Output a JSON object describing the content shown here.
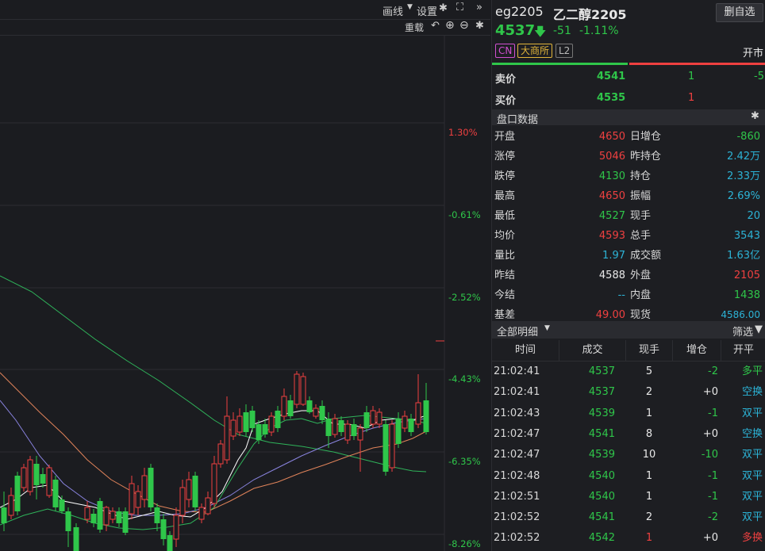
{
  "toolbar": {
    "draw_label": "画线",
    "settings_label": "设置",
    "reload_label": "重载"
  },
  "axis_labels": [
    "1.30%",
    "-0.61%",
    "-2.52%",
    "-4.43%",
    "-6.35%",
    "-8.26%"
  ],
  "axis_colors": {
    "positive": "#ef4040",
    "negative": "#2fc64a"
  },
  "quote": {
    "symbol": "eg2205",
    "name": "乙二醇2205",
    "delete_label": "删自选",
    "price": "4537",
    "change": "-51",
    "change_pct": "-1.11%",
    "tags": [
      "CN",
      "大商所",
      "L2"
    ],
    "status": "开市"
  },
  "order_book": [
    {
      "label": "卖价",
      "price": "4541",
      "vol": "1",
      "delta": "-5"
    },
    {
      "label": "买价",
      "price": "4535",
      "vol": "1",
      "delta": ""
    }
  ],
  "panel_header": "盘口数据",
  "stats_left": [
    {
      "label": "开盘",
      "value": "4650",
      "color": "red"
    },
    {
      "label": "涨停",
      "value": "5046",
      "color": "red"
    },
    {
      "label": "跌停",
      "value": "4130",
      "color": "green"
    },
    {
      "label": "最高",
      "value": "4650",
      "color": "red"
    },
    {
      "label": "最低",
      "value": "4527",
      "color": "green"
    },
    {
      "label": "均价",
      "value": "4593",
      "color": "red"
    },
    {
      "label": "量比",
      "value": "1.97",
      "color": "cyan"
    },
    {
      "label": "昨结",
      "value": "4588",
      "color": "white"
    },
    {
      "label": "今结",
      "value": "--",
      "color": "cyan"
    },
    {
      "label": "基差",
      "value": "49.00",
      "color": "red"
    }
  ],
  "stats_right": [
    {
      "label": "日增仓",
      "value": "-860",
      "color": "green"
    },
    {
      "label": "昨持仓",
      "value": "2.42万",
      "color": "cyan"
    },
    {
      "label": "持仓",
      "value": "2.33万",
      "color": "cyan"
    },
    {
      "label": "振幅",
      "value": "2.69%",
      "color": "cyan"
    },
    {
      "label": "现手",
      "value": "20",
      "color": "cyan"
    },
    {
      "label": "总手",
      "value": "3543",
      "color": "cyan"
    },
    {
      "label": "成交额",
      "value": "1.63亿",
      "color": "cyan"
    },
    {
      "label": "外盘",
      "value": "2105",
      "color": "red"
    },
    {
      "label": "内盘",
      "value": "1438",
      "color": "green"
    },
    {
      "label": "现货",
      "value": "4586.00",
      "color": "cyan"
    }
  ],
  "detail_header": {
    "title": "全部明细",
    "filter_label": "筛选"
  },
  "trade_columns": [
    "时间",
    "成交",
    "现手",
    "增仓",
    "开平"
  ],
  "trades": [
    {
      "time": "21:02:41",
      "price": "4537",
      "vol": "5",
      "oi": "-2",
      "type": "多平",
      "pc": "green",
      "vc": "white",
      "oc": "green",
      "tc": "green"
    },
    {
      "time": "21:02:41",
      "price": "4537",
      "vol": "2",
      "oi": "+0",
      "type": "空换",
      "pc": "green",
      "vc": "white",
      "oc": "white",
      "tc": "cyan"
    },
    {
      "time": "21:02:43",
      "price": "4539",
      "vol": "1",
      "oi": "-1",
      "type": "双平",
      "pc": "green",
      "vc": "white",
      "oc": "green",
      "tc": "cyan"
    },
    {
      "time": "21:02:47",
      "price": "4541",
      "vol": "8",
      "oi": "+0",
      "type": "空换",
      "pc": "green",
      "vc": "white",
      "oc": "white",
      "tc": "cyan"
    },
    {
      "time": "21:02:47",
      "price": "4539",
      "vol": "10",
      "oi": "-10",
      "type": "双平",
      "pc": "green",
      "vc": "white",
      "oc": "green",
      "tc": "cyan"
    },
    {
      "time": "21:02:48",
      "price": "4540",
      "vol": "1",
      "oi": "-1",
      "type": "双平",
      "pc": "green",
      "vc": "white",
      "oc": "green",
      "tc": "cyan"
    },
    {
      "time": "21:02:51",
      "price": "4540",
      "vol": "1",
      "oi": "-1",
      "type": "双平",
      "pc": "green",
      "vc": "white",
      "oc": "green",
      "tc": "cyan"
    },
    {
      "time": "21:02:52",
      "price": "4541",
      "vol": "2",
      "oi": "-2",
      "type": "双平",
      "pc": "green",
      "vc": "white",
      "oc": "green",
      "tc": "cyan"
    },
    {
      "time": "21:02:52",
      "price": "4542",
      "vol": "1",
      "oi": "+0",
      "type": "多换",
      "pc": "green",
      "vc": "red",
      "oc": "white",
      "tc": "red"
    }
  ]
}
